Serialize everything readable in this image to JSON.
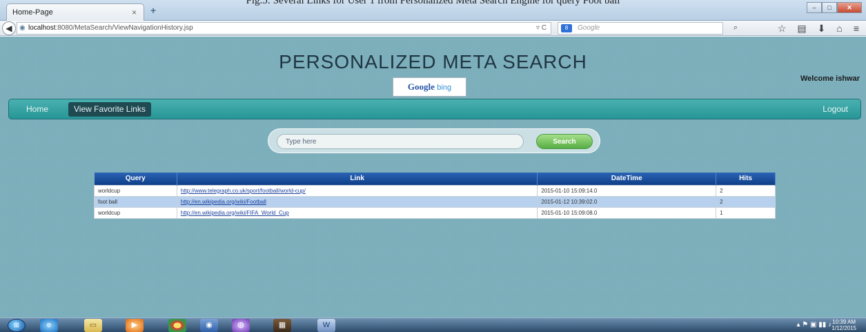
{
  "caption": "Fig.5: Several Links for User 1 from Personalized Meta Search Engine for query Foot ball",
  "browser": {
    "tab_title": "Home-Page",
    "tab_close": "×",
    "new_tab": "+",
    "url_host": "localhost",
    "url_rest": ":8080/MetaSearch/ViewNavigationHistory.jsp",
    "search_engine_badge": "8",
    "search_placeholder": "Google",
    "window_buttons": [
      "–",
      "□",
      "✕"
    ]
  },
  "site": {
    "title": "PERSONALIZED META SEARCH",
    "logo_google": "Google",
    "logo_bing": "bing",
    "welcome": "Welcome ishwar",
    "menu": {
      "home": "Home",
      "favorites": "View Favorite Links",
      "logout": "Logout"
    },
    "search": {
      "placeholder": "Type here",
      "button": "Search"
    }
  },
  "history": {
    "columns": [
      "Query",
      "Link",
      "DateTime",
      "Hits"
    ],
    "rows": [
      {
        "query": "worldcup",
        "link": "http://www.telegraph.co.uk/sport/football/world-cup/",
        "datetime": "2015-01-10 15:09:14.0",
        "hits": "2"
      },
      {
        "query": "foot ball",
        "link": "http://en.wikipedia.org/wiki/Football",
        "datetime": "2015-01-12 10:39:02.0",
        "hits": "2"
      },
      {
        "query": "worldcup",
        "link": "http://en.wikipedia.org/wiki/FIFA_World_Cup",
        "datetime": "2015-01-10 15:09:08.0",
        "hits": "1"
      }
    ]
  },
  "taskbar": {
    "clock_time": "10:39 AM",
    "clock_date": "1/12/2015"
  },
  "colors": {
    "page_bg": "#7aadba",
    "menubar": "#279696",
    "table_header": "#0e3f88",
    "row_alt": "#b6d0ee",
    "search_button": "#56ad43"
  }
}
